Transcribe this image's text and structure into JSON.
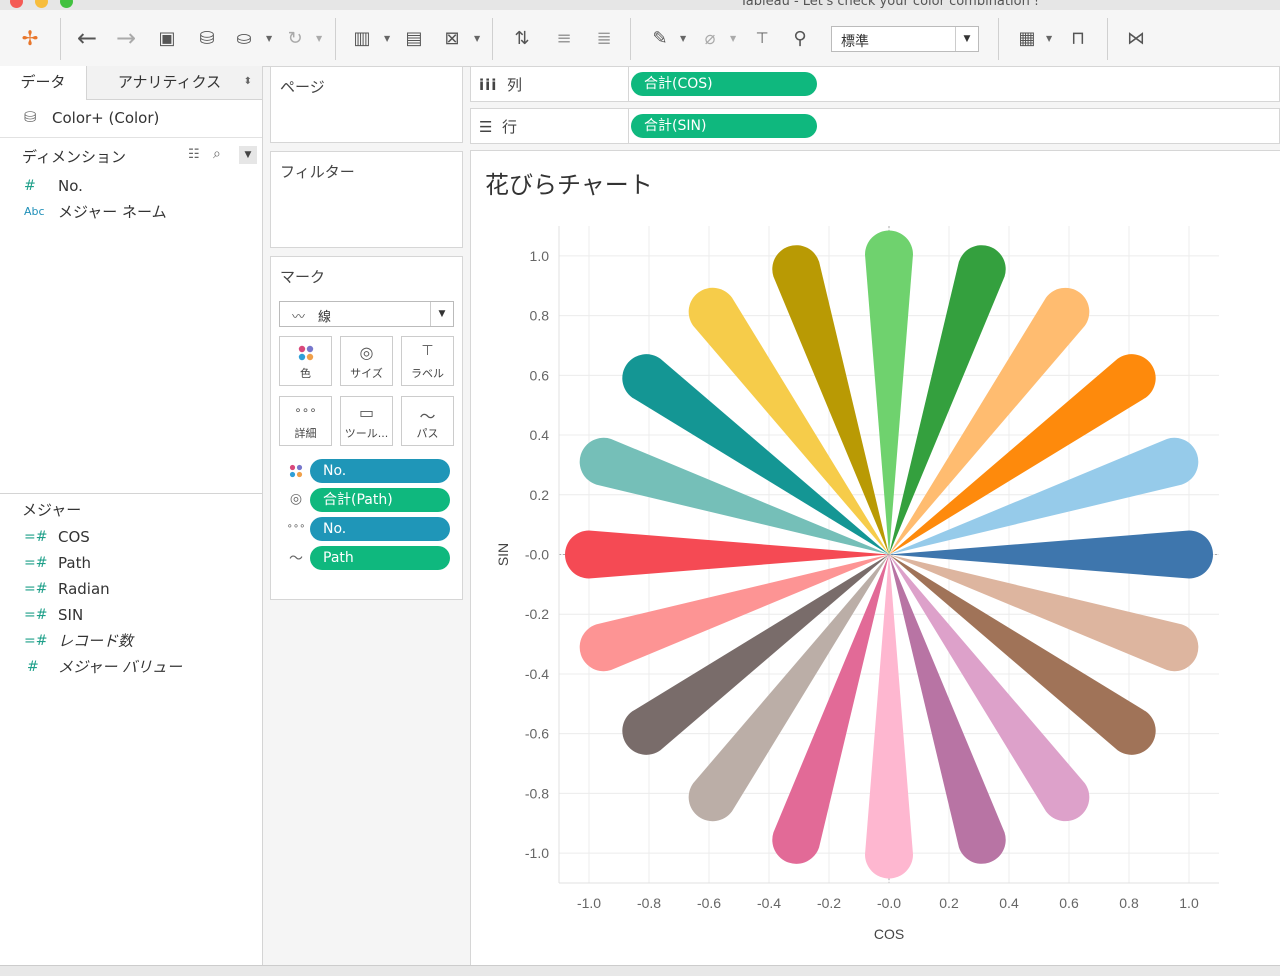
{
  "window": {
    "title": "Tableau - Let's check your color combination !"
  },
  "toolbar": {
    "fit_value": "標準",
    "icons": [
      "tableau-logo-icon",
      "back-arrow-icon",
      "forward-arrow-icon",
      "save-icon",
      "new-datasource-icon",
      "datasource-pause-icon",
      "refresh-icon",
      "new-worksheet-icon",
      "duplicate-sheet-icon",
      "clear-sheet-icon",
      "swap-icon",
      "sort-ascending-icon",
      "sort-descending-icon",
      "highlight-icon",
      "attach-icon",
      "text-label-icon",
      "pin-icon",
      "show-cards-icon",
      "presentation-icon",
      "share-icon"
    ]
  },
  "datapane": {
    "tab_data": "データ",
    "tab_analytics": "アナリティクス",
    "datasource": "Color+ (Color)",
    "dimensions_label": "ディメンション",
    "dimensions": [
      {
        "type": "#",
        "name": "No."
      },
      {
        "type": "Abc",
        "name": "メジャー ネーム"
      }
    ],
    "measures_label": "メジャー",
    "measures": [
      {
        "type": "=#",
        "name": "COS"
      },
      {
        "type": "=#",
        "name": "Path"
      },
      {
        "type": "=#",
        "name": "Radian"
      },
      {
        "type": "=#",
        "name": "SIN"
      },
      {
        "type": "=#",
        "name": "レコード数"
      },
      {
        "type": "#",
        "name": "メジャー バリュー"
      }
    ]
  },
  "shelves": {
    "pages_label": "ページ",
    "filters_label": "フィルター",
    "marks_label": "マーク",
    "mark_type": "線",
    "mark_buttons": [
      "色",
      "サイズ",
      "ラベル",
      "詳細",
      "ツール...",
      "パス"
    ],
    "mark_pills": [
      {
        "role": "color",
        "label": "No.",
        "color": "#1f96b8"
      },
      {
        "role": "size",
        "label": "合計(Path)",
        "color": "#0fb87e"
      },
      {
        "role": "detail",
        "label": "No.",
        "color": "#1f96b8"
      },
      {
        "role": "path",
        "label": "Path",
        "color": "#0fb87e"
      }
    ],
    "columns_label": "列",
    "columns_pill": "合計(COS)",
    "rows_label": "行",
    "rows_pill": "合計(SIN)"
  },
  "view": {
    "title": "花びらチャート"
  },
  "chart_data": {
    "type": "line",
    "title": "花びらチャート",
    "xlabel": "COS",
    "ylabel": "SIN",
    "xlim": [
      -1.1,
      1.1
    ],
    "ylim": [
      -1.1,
      1.1
    ],
    "x_ticks": [
      "-1.0",
      "-0.8",
      "-0.6",
      "-0.4",
      "-0.2",
      "-0.0",
      "0.2",
      "0.4",
      "0.6",
      "0.8",
      "1.0"
    ],
    "y_ticks": [
      "1.0",
      "0.8",
      "0.6",
      "0.4",
      "0.2",
      "-0.0",
      "-0.2",
      "-0.4",
      "-0.6",
      "-0.8",
      "-1.0"
    ],
    "grid": true,
    "petals": [
      {
        "angle_deg": 0,
        "color": "#3e76ad"
      },
      {
        "angle_deg": 18,
        "color": "#96cbea"
      },
      {
        "angle_deg": 36,
        "color": "#fe8a0c"
      },
      {
        "angle_deg": 54,
        "color": "#ffbc70"
      },
      {
        "angle_deg": 72,
        "color": "#34a03e"
      },
      {
        "angle_deg": 90,
        "color": "#6fd26e"
      },
      {
        "angle_deg": 108,
        "color": "#b99a04"
      },
      {
        "angle_deg": 126,
        "color": "#f6cc4a"
      },
      {
        "angle_deg": 144,
        "color": "#149694"
      },
      {
        "angle_deg": 162,
        "color": "#75bfb8"
      },
      {
        "angle_deg": 180,
        "color": "#f54a54"
      },
      {
        "angle_deg": 198,
        "color": "#fd9494"
      },
      {
        "angle_deg": 216,
        "color": "#796c6a"
      },
      {
        "angle_deg": 234,
        "color": "#bbaea7"
      },
      {
        "angle_deg": 252,
        "color": "#e26a97"
      },
      {
        "angle_deg": 270,
        "color": "#feb7d0"
      },
      {
        "angle_deg": 288,
        "color": "#b874a4"
      },
      {
        "angle_deg": 306,
        "color": "#dda1ca"
      },
      {
        "angle_deg": 324,
        "color": "#a07358"
      },
      {
        "angle_deg": 342,
        "color": "#ddb59f"
      }
    ],
    "petal_length": 1.0
  }
}
